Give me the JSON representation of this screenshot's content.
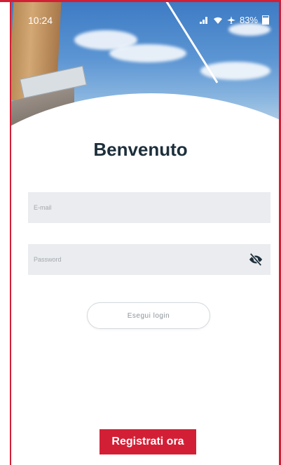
{
  "status_bar": {
    "time": "10:24",
    "signal_text": "↑↓",
    "battery_text": "83%"
  },
  "login": {
    "title": "Benvenuto",
    "email_placeholder": "E-mail",
    "password_placeholder": "Password",
    "login_button": "Esegui login",
    "register_button": "Registrati ora"
  },
  "colors": {
    "accent": "#d31f35",
    "title": "#1d2f3b",
    "field_background": "#eaecef"
  },
  "icons": {
    "password_toggle": "eye-slash-icon"
  }
}
